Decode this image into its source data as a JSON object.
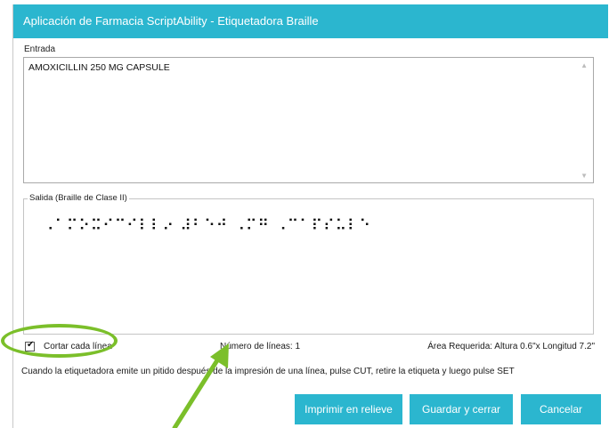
{
  "window": {
    "title": "Aplicación de Farmacia ScriptAbility - Etiquetadora Braille"
  },
  "input": {
    "label": "Entrada",
    "value": "AMOXICILLIN 250 MG CAPSULE",
    "scroll_up_icon": "▲",
    "scroll_down_icon": "▼"
  },
  "output": {
    "label": "Salida (Braille de Clase II)",
    "braille": "⠠⠁⠍⠕⠭⠊⠉⠊⠇⠇⠔ ⠼⠃⠑⠚ ⠠⠍⠛ ⠠⠉⠁⠏⠎⠥⠇⠑"
  },
  "options": {
    "cut_each_line_label": "Cortar cada línea",
    "cut_each_line_checked": true,
    "line_count_label": "Número de líneas: 1",
    "required_area_label": "Área Requerida: Altura 0.6\"x Longitud 7.2\""
  },
  "instructions": "Cuando la etiquetadora emite un pitido después de la impresión de una línea, pulse CUT, retire la etiqueta y luego pulse SET",
  "buttons": {
    "emboss": "Imprimir en relieve",
    "save_close": "Guardar y cerrar",
    "cancel": "Cancelar"
  },
  "colors": {
    "accent": "#2bb6cf",
    "highlight": "#7bbf2a"
  }
}
